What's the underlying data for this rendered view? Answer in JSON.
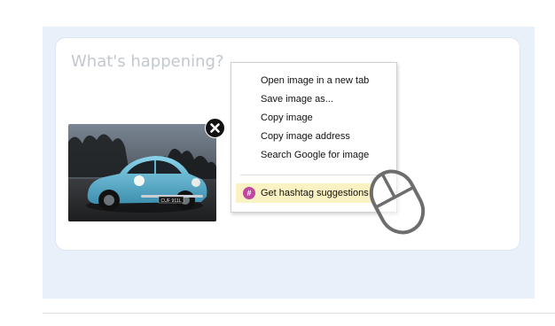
{
  "composer": {
    "placeholder": "What's happening?"
  },
  "image": {
    "plate_text": "CUF 911L"
  },
  "context_menu": {
    "items": [
      {
        "label": "Open image in a new tab"
      },
      {
        "label": "Save image as..."
      },
      {
        "label": "Copy image"
      },
      {
        "label": "Copy image address"
      },
      {
        "label": "Search Google for image"
      }
    ],
    "extension_item": {
      "label": "Get hashtag suggestions",
      "icon": "hashtag-icon",
      "icon_glyph": "#",
      "highlight_color": "#fbf2c4",
      "icon_color": "#c0479f"
    }
  },
  "colors": {
    "panel_background": "#e8f0fa",
    "car_body": "#5fb3cf"
  }
}
